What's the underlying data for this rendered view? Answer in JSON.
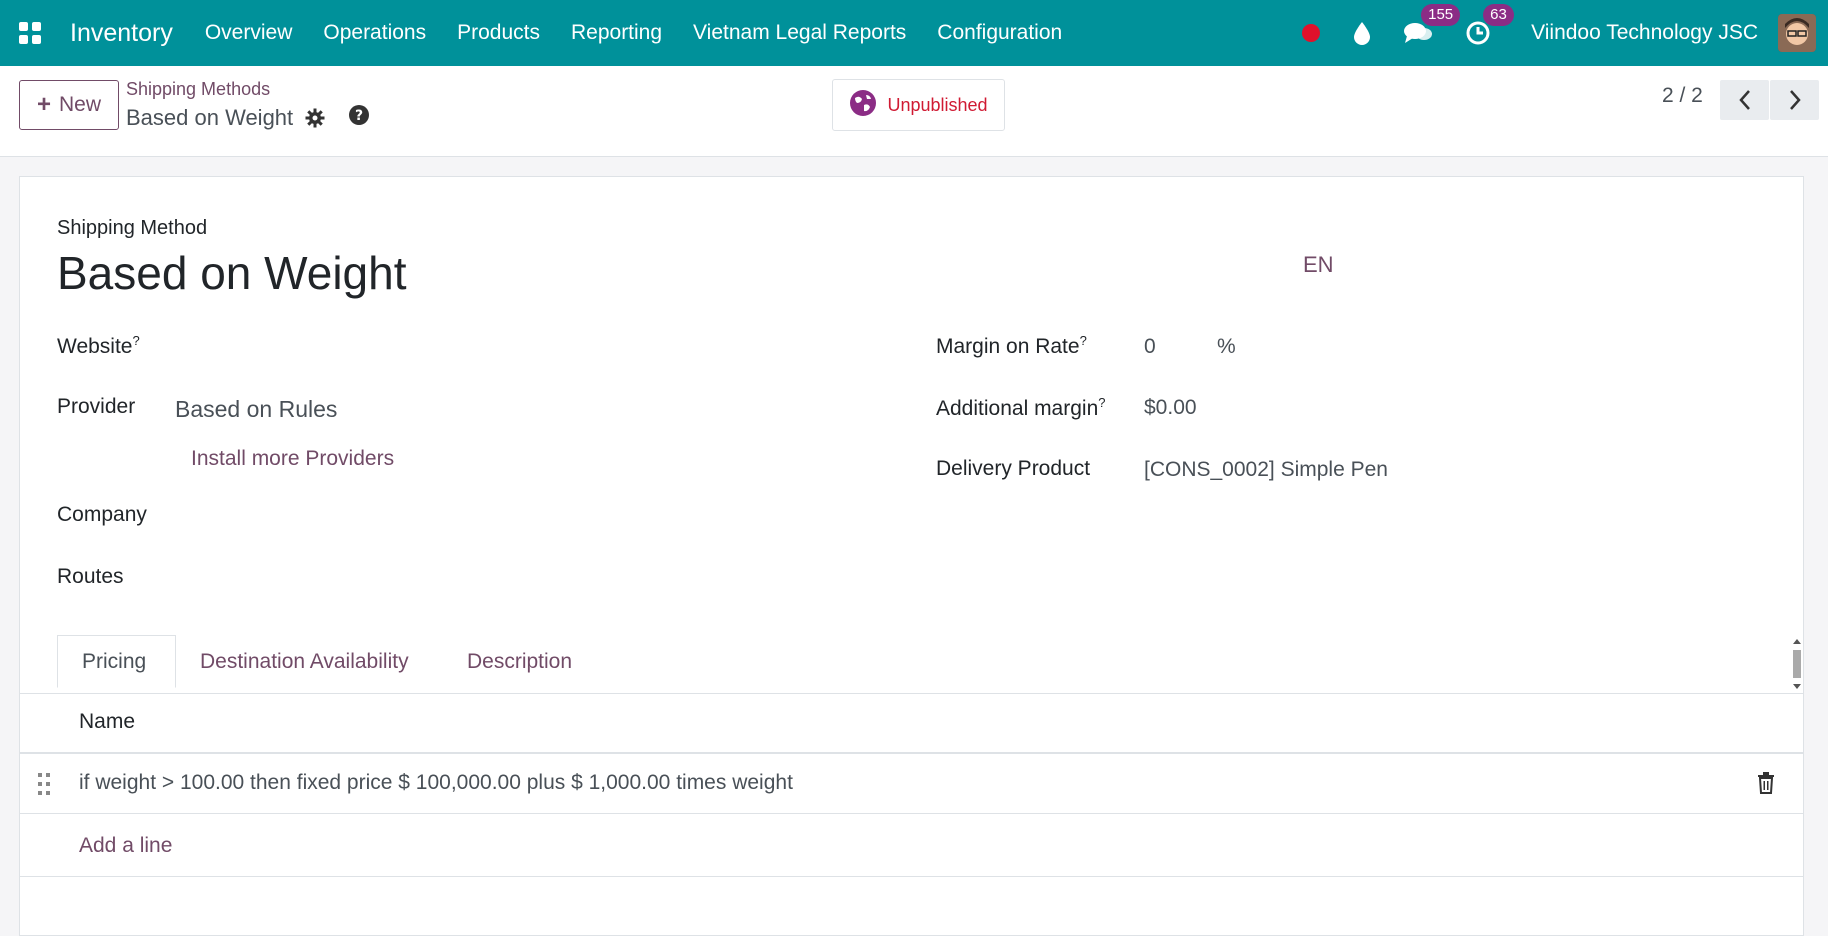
{
  "navbar": {
    "app_name": "Inventory",
    "menus": [
      "Overview",
      "Operations",
      "Products",
      "Reporting",
      "Vietnam Legal Reports",
      "Configuration"
    ],
    "messages_count": "155",
    "activities_count": "63",
    "company": "Viindoo Technology JSC"
  },
  "control": {
    "new_label": "New",
    "breadcrumb_parent": "Shipping Methods",
    "breadcrumb_current": "Based on Weight",
    "publish_status": "Unpublished",
    "pager": "2 / 2"
  },
  "form": {
    "heading_label": "Shipping Method",
    "name": "Based on Weight",
    "lang": "EN",
    "website_label": "Website",
    "provider_label": "Provider",
    "provider_value": "Based on Rules",
    "install_more": "Install more Providers",
    "company_label": "Company",
    "routes_label": "Routes",
    "margin_rate_label": "Margin on Rate",
    "margin_rate_value": "0",
    "margin_rate_unit": "%",
    "additional_margin_label": "Additional margin",
    "additional_margin_value": "$0.00",
    "delivery_product_label": "Delivery Product",
    "delivery_product_value": "[CONS_0002] Simple Pen",
    "help_marker": "?"
  },
  "tabs": [
    "Pricing",
    "Destination Availability",
    "Description"
  ],
  "pricing": {
    "column_name": "Name",
    "rows": [
      "if weight > 100.00 then fixed price $ 100,000.00 plus $ 1,000.00 times weight"
    ],
    "add_line": "Add a line"
  },
  "colors": {
    "navbar": "#00919a",
    "accent": "#714b67",
    "unpublished": "#d01a33",
    "badge": "#8b2c85"
  }
}
